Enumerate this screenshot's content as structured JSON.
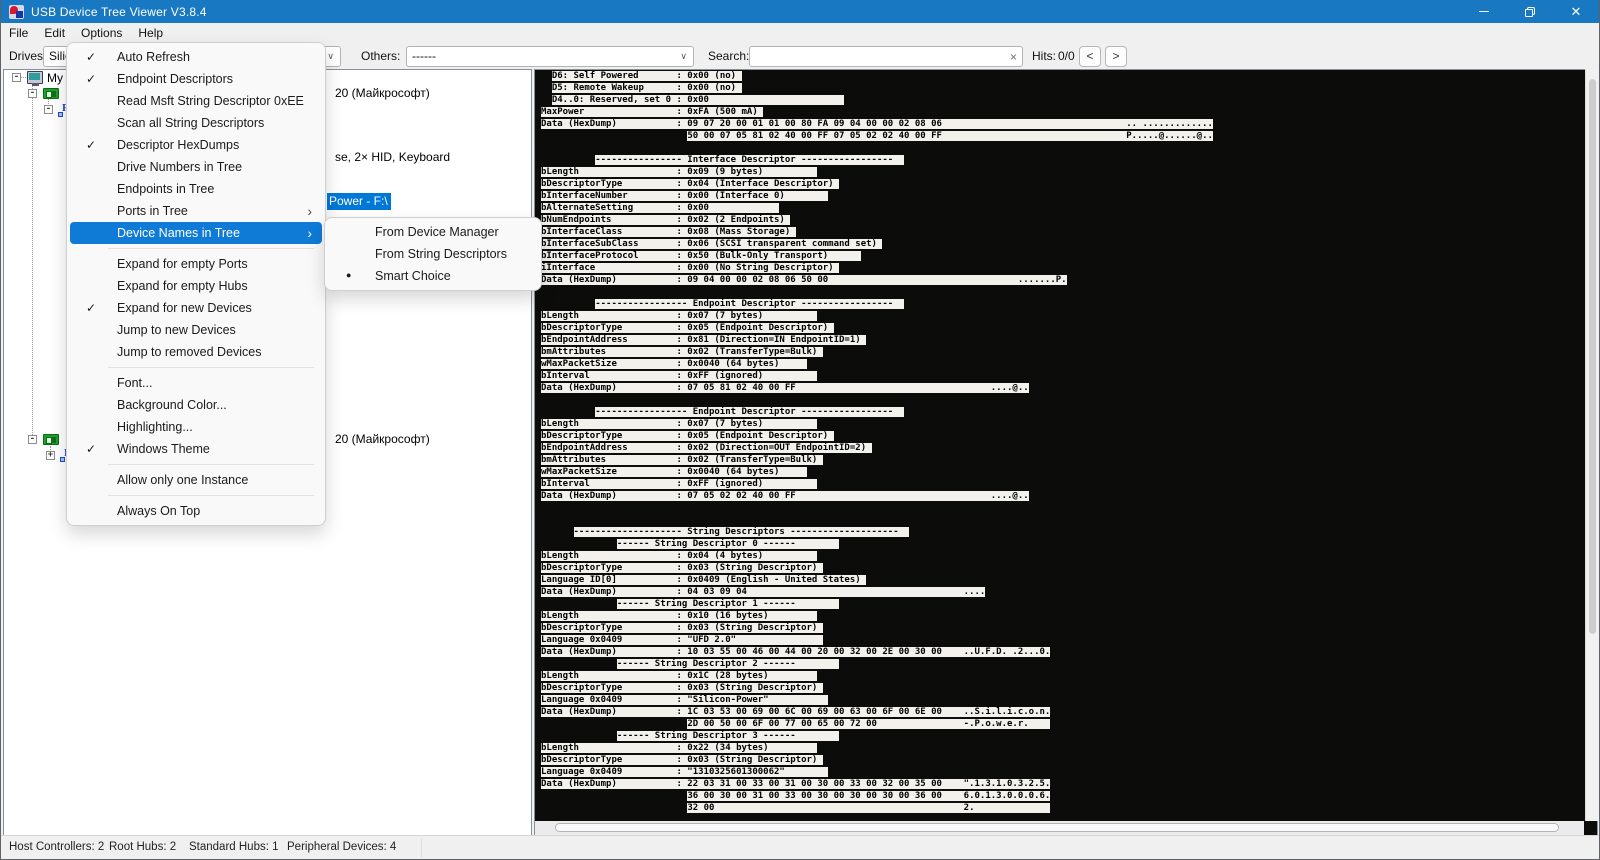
{
  "window": {
    "title": "USB Device Tree Viewer V3.8.4"
  },
  "menu_bar": [
    "File",
    "Edit",
    "Options",
    "Help"
  ],
  "toolbar": {
    "drives_label": "Drives:",
    "drives_value": "Silic",
    "others_label": "Others:",
    "others_value": "------",
    "search_label": "Search:",
    "search_value": "",
    "clear_glyph": "×",
    "hits_label": "Hits:",
    "hits_value": "0/0",
    "prev_glyph": "<",
    "next_glyph": ">"
  },
  "options_menu": {
    "items": [
      {
        "label": "Auto Refresh",
        "checked": true
      },
      {
        "label": "Endpoint Descriptors",
        "checked": true
      },
      {
        "label": "Read Msft String Descriptor 0xEE"
      },
      {
        "label": "Scan all String Descriptors"
      },
      {
        "label": "Descriptor HexDumps",
        "checked": true
      },
      {
        "label": "Drive Numbers in Tree"
      },
      {
        "label": "Endpoints in Tree"
      },
      {
        "label": "Ports in Tree",
        "submenu": true
      },
      {
        "label": "Device Names in Tree",
        "submenu": true,
        "highlighted": true
      },
      {
        "separator": true
      },
      {
        "label": "Expand for empty Ports"
      },
      {
        "label": "Expand for empty Hubs"
      },
      {
        "label": "Expand for new Devices",
        "checked": true
      },
      {
        "label": "Jump to new Devices"
      },
      {
        "label": "Jump to removed Devices"
      },
      {
        "separator": true
      },
      {
        "label": "Font..."
      },
      {
        "label": "Background Color..."
      },
      {
        "label": "Highlighting..."
      },
      {
        "label": "Windows Theme",
        "checked": true
      },
      {
        "separator": true
      },
      {
        "label": "Allow only one Instance"
      },
      {
        "separator": true
      },
      {
        "label": "Always On Top"
      }
    ]
  },
  "sub_menu": {
    "items": [
      {
        "label": "From Device Manager"
      },
      {
        "label": "From String Descriptors"
      },
      {
        "label": "Smart Choice",
        "bullet": true
      }
    ]
  },
  "tree": {
    "root_fragment": "My C",
    "selected_item": "Power - F:\\",
    "fragments": [
      {
        "text": "20 (Майкрософт)"
      },
      {
        "text": "se, 2× HID, Keyboard"
      },
      {
        "text": "20 (Майкрософт)"
      }
    ]
  },
  "detail_panel": {
    "lines": [
      "  D6: Self Powered       : 0x00 (no) ",
      "  D5: Remote Wakeup      : 0x00 (no) ",
      "  D4..0: Reserved, set 0 : 0x00                         ",
      "MaxPower                 : 0xFA (500 mA) ",
      "Data (HexDump)           : 09 07 20 00 01 01 00 80 FA 09 04 00 00 02 08 06                                  .. .............",
      "                           50 00 07 05 81 02 40 00 FF 07 05 02 02 40 00 FF                                  P.....@......@..",
      "",
      "          ---------------- Interface Descriptor -----------------  ",
      "bLength                  : 0x09 (9 bytes)          ",
      "bDescriptorType          : 0x04 (Interface Descriptor) ",
      "bInterfaceNumber         : 0x00 (Interface 0)        ",
      "bAlternateSetting        : 0x00             ",
      "bNumEndpoints            : 0x02 (2 Endpoints) ",
      "bInterfaceClass          : 0x08 (Mass Storage) ",
      "bInterfaceSubClass       : 0x06 (SCSI transparent command set) ",
      "bInterfaceProtocol       : 0x50 (Bulk-Only Transport)      ",
      "iInterface               : 0x00 (No String Descriptor) ",
      "Data (HexDump)           : 09 04 00 00 02 08 06 50 00                                   .......P.",
      "",
      "          ----------------- Endpoint Descriptor -----------------  ",
      "bLength                  : 0x07 (7 bytes)          ",
      "bDescriptorType          : 0x05 (Endpoint Descriptor) ",
      "bEndpointAddress         : 0x81 (Direction=IN EndpointID=1) ",
      "bmAttributes             : 0x02 (TransferType=Bulk) ",
      "wMaxPacketSize           : 0x0040 (64 bytes)     ",
      "bInterval                : 0xFF (ignored)          ",
      "Data (HexDump)           : 07 05 81 02 40 00 FF                                    ....@..",
      "",
      "          ----------------- Endpoint Descriptor -----------------  ",
      "bLength                  : 0x07 (7 bytes)          ",
      "bDescriptorType          : 0x05 (Endpoint Descriptor) ",
      "bEndpointAddress         : 0x02 (Direction=OUT EndpointID=2) ",
      "bmAttributes             : 0x02 (TransferType=Bulk) ",
      "wMaxPacketSize           : 0x0040 (64 bytes)     ",
      "bInterval                : 0xFF (ignored)          ",
      "Data (HexDump)           : 07 05 02 02 40 00 FF                                    ....@..",
      "",
      "",
      "      -------------------- String Descriptors --------------------  ",
      "              ------ String Descriptor 0 ------        ",
      "bLength                  : 0x04 (4 bytes)          ",
      "bDescriptorType          : 0x03 (String Descriptor) ",
      "Language ID[0]           : 0x0409 (English - United States) ",
      "Data (HexDump)           : 04 03 09 04                                        ....",
      "              ------ String Descriptor 1 ------        ",
      "bLength                  : 0x10 (16 bytes)         ",
      "bDescriptorType          : 0x03 (String Descriptor) ",
      "Language 0x0409          : \"UFD 2.0\"                ",
      "Data (HexDump)           : 10 03 55 00 46 00 44 00 20 00 32 00 2E 00 30 00    ..U.F.D. .2...0.",
      "              ------ String Descriptor 2 ------        ",
      "bLength                  : 0x1C (28 bytes)         ",
      "bDescriptorType          : 0x03 (String Descriptor) ",
      "Language 0x0409          : \"Silicon-Power\"           ",
      "Data (HexDump)           : 1C 03 53 00 69 00 6C 00 69 00 63 00 6F 00 6E 00    ..S.i.l.i.c.o.n.",
      "                           2D 00 50 00 6F 00 77 00 65 00 72 00                -.P.o.w.e.r.    ",
      "              ------ String Descriptor 3 ------        ",
      "bLength                  : 0x22 (34 bytes)         ",
      "bDescriptorType          : 0x03 (String Descriptor) ",
      "Language 0x0409          : \"1310325601300062\"        ",
      "Data (HexDump)           : 22 03 31 00 33 00 31 00 30 00 33 00 32 00 35 00    \".1.3.1.0.3.2.5.",
      "                           36 00 30 00 31 00 33 00 30 00 30 00 30 00 36 00    6.0.1.3.0.0.0.6.",
      "                           32 00                                              2.              "
    ]
  },
  "status_bar": {
    "items": [
      "Host Controllers: 2",
      "Root Hubs: 2",
      "Standard Hubs: 1",
      "Peripheral Devices: 4"
    ]
  },
  "colors": {
    "titlebar": "#1878c2",
    "menu_highlight": "#0f7bd7",
    "tree_selection": "#0078d7",
    "panel_background": "#0c0c0a",
    "panel_text_strip": "#f2f1ec"
  }
}
